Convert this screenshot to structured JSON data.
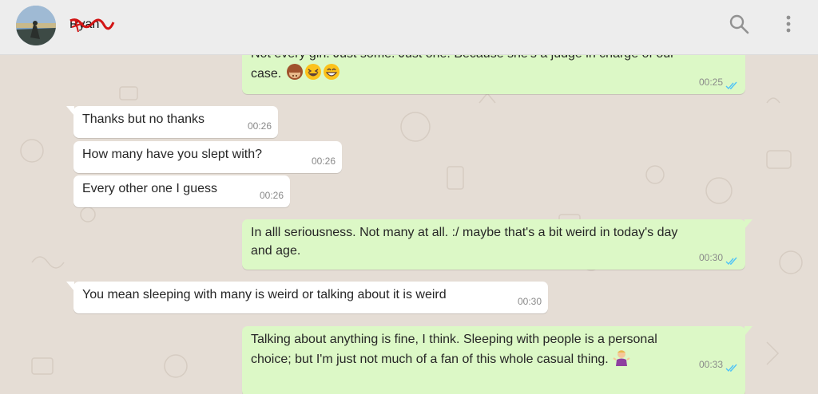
{
  "header": {
    "contact_name": "Ryan",
    "icons": [
      "search-icon",
      "menu-icon"
    ]
  },
  "colors": {
    "incoming_bubble": "#ffffff",
    "outgoing_bubble": "#dcf8c6",
    "read_ticks": "#4fc3f7",
    "wallpaper": "#e5ddd5",
    "header": "#ededed"
  },
  "messages": [
    {
      "direction": "out",
      "text": "Not every girl. Just some. Just one. Because she's a judge in charge of our",
      "text2": "case.",
      "emojis": [
        "see-no-evil-monkey",
        "laughing-face",
        "grinning-face"
      ],
      "time": "00:25",
      "status": "read"
    },
    {
      "direction": "in",
      "text": "Thanks but no thanks",
      "time": "00:26"
    },
    {
      "direction": "in",
      "text": "How many have you slept with?",
      "time": "00:26"
    },
    {
      "direction": "in",
      "text": "Every other one I guess",
      "time": "00:26"
    },
    {
      "direction": "out",
      "text": "In alll seriousness. Not many at all. :/ maybe that's a bit weird in today's day",
      "text2": "and age.",
      "time": "00:30",
      "status": "read"
    },
    {
      "direction": "in",
      "text": "You mean sleeping with many is weird or talking about it is weird",
      "time": "00:30"
    },
    {
      "direction": "out",
      "text": "Talking about anything is fine, I think. Sleeping with people is a personal",
      "text2": "choice; but I'm just not much of a fan of this whole casual thing.",
      "emojis": [
        "woman-shrugging"
      ],
      "time": "00:33",
      "status": "read"
    }
  ]
}
